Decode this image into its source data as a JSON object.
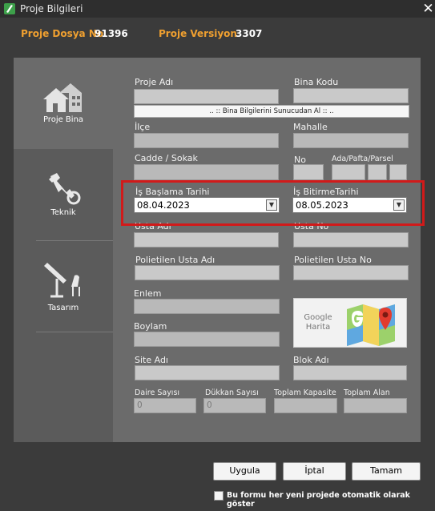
{
  "window": {
    "title": "Proje Bilgileri",
    "close_glyph": "✕"
  },
  "header": {
    "dosya_label": "Proje Dosya No",
    "dosya_value": "91396",
    "versiyon_label": "Proje Versiyon",
    "versiyon_value": "3307"
  },
  "nav": [
    {
      "label": "Proje Bina",
      "icon": "building-icon",
      "active": true
    },
    {
      "label": "Teknik",
      "icon": "wrench-icon",
      "active": false
    },
    {
      "label": "Tasarım",
      "icon": "drafting-table-icon",
      "active": false
    }
  ],
  "form": {
    "proje_adi": {
      "label": "Proje Adı",
      "value": ""
    },
    "bina_kodu": {
      "label": "Bina Kodu",
      "value": ""
    },
    "fetch_button": ".. :: Bina Bilgilerini Sunucudan Al :: ..",
    "ilce": {
      "label": "İlçe",
      "value": ""
    },
    "mahalle": {
      "label": "Mahalle",
      "value": ""
    },
    "cadde": {
      "label": "Cadde / Sokak",
      "value": ""
    },
    "no": {
      "label": "No",
      "value": ""
    },
    "ada_pafta_parsel": {
      "label": "Ada/Pafta/Parsel",
      "values": [
        "",
        "",
        ""
      ]
    },
    "is_baslama": {
      "label": "İş Başlama Tarihi",
      "value": "08.04.2023"
    },
    "is_bitirme": {
      "label": "İş BitirmeTarihi",
      "value": "08.05.2023"
    },
    "usta_adi": {
      "label": "Usta Adı",
      "value": ""
    },
    "usta_no": {
      "label": "Usta No",
      "value": ""
    },
    "polietilen_usta_adi": {
      "label": "Polietilen Usta Adı",
      "value": ""
    },
    "polietilen_usta_no": {
      "label": "Polietilen Usta No",
      "value": ""
    },
    "enlem": {
      "label": "Enlem",
      "value": ""
    },
    "boylam": {
      "label": "Boylam",
      "value": ""
    },
    "google_harita": {
      "line1": "Google",
      "line2": "Harita"
    },
    "site_adi": {
      "label": "Site Adı",
      "value": ""
    },
    "blok_adi": {
      "label": "Blok Adı",
      "value": ""
    },
    "daire_sayisi": {
      "label": "Daire Sayısı",
      "value": "0"
    },
    "dukkan_sayisi": {
      "label": "Dükkan Sayısı",
      "value": "0"
    },
    "toplam_kapasite": {
      "label": "Toplam Kapasite",
      "value": ""
    },
    "toplam_alan": {
      "label": "Toplam Alan",
      "value": ""
    }
  },
  "buttons": {
    "uygula": "Uygula",
    "iptal": "İptal",
    "tamam": "Tamam"
  },
  "checkbox": {
    "label": "Bu formu her yeni projede otomatik olarak göster",
    "checked": false
  },
  "colors": {
    "accent": "#f0a030",
    "highlight": "#d11a1a",
    "panel": "#6b6b6b",
    "background": "#3b3b3b"
  }
}
